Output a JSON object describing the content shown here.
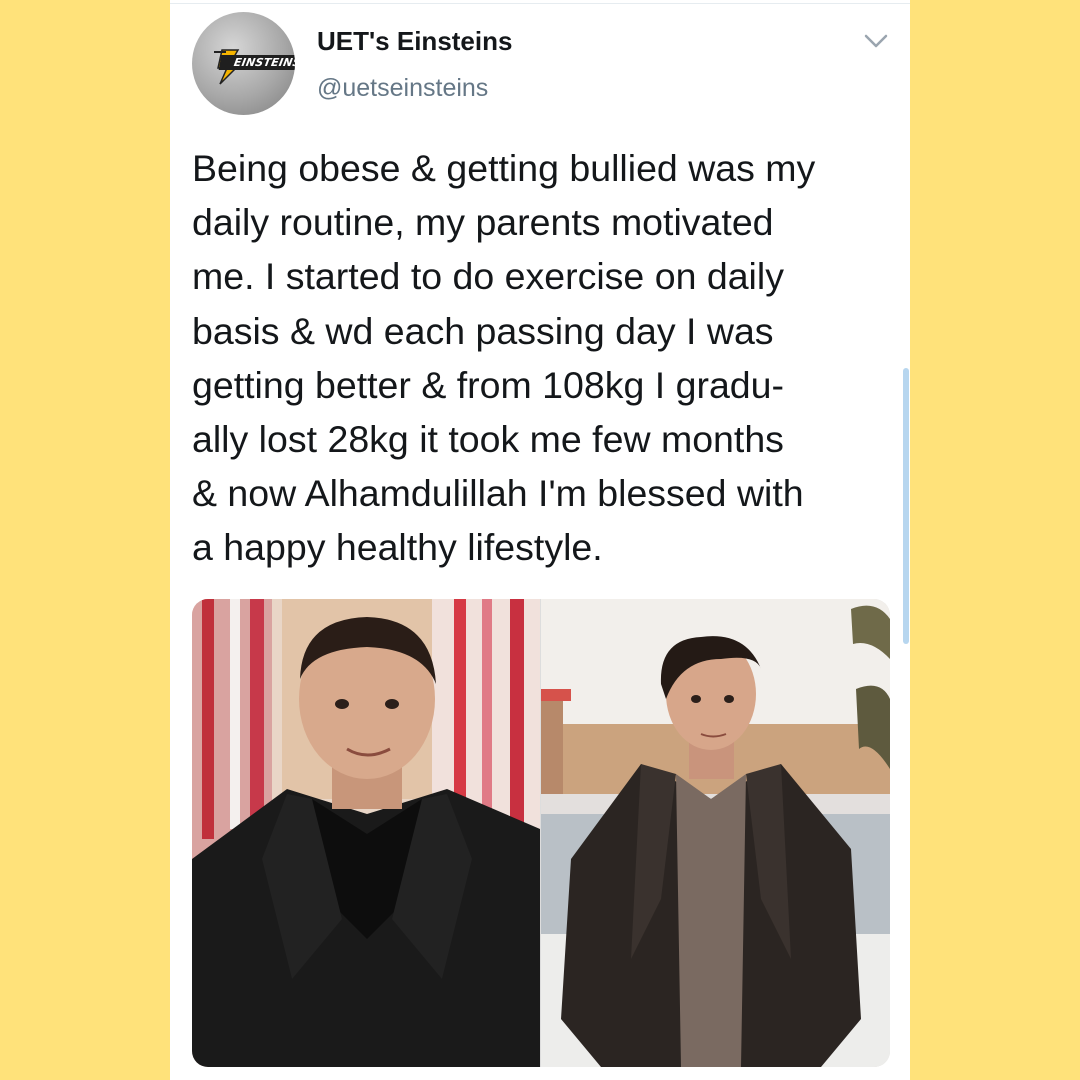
{
  "tweet": {
    "display_name": "UET's Einsteins",
    "handle": "@uetseinsteins",
    "avatar_logo_text": "EINSTEINS",
    "avatar_logo_small": "UET'S",
    "text_lines": [
      "Being obese & getting bullied was my",
      "daily routine, my parents motivated",
      "me. I started to do exercise on daily",
      "basis & wd each passing day I was",
      "getting better & from 108kg I gradu-",
      "ally lost 28kg it took me few months",
      "& now Alhamdulillah I'm blessed with",
      "a happy healthy lifestyle."
    ],
    "menu_icon": "chevron-down-icon"
  },
  "colors": {
    "background": "#FFE27A",
    "card": "#FFFFFF",
    "text": "#14171A",
    "secondary_text": "#657786",
    "scrollbar": "#B7D6EF"
  }
}
